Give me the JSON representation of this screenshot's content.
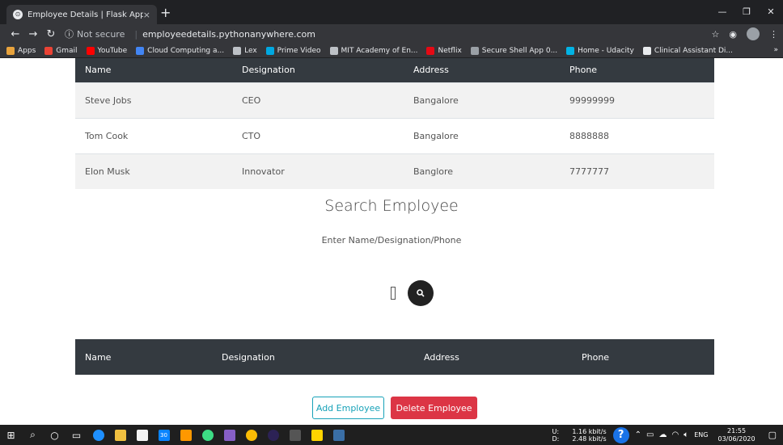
{
  "browser": {
    "tab_title": "Employee Details | Flask App",
    "tab_close": "×",
    "new_tab": "+",
    "not_secure": "Not secure",
    "url": "employeedetails.pythonanywhere.com",
    "bookmarks": [
      {
        "label": "Apps",
        "color": "#e8a33d"
      },
      {
        "label": "Gmail",
        "color": "#ea4335"
      },
      {
        "label": "YouTube",
        "color": "#ff0000"
      },
      {
        "label": "Cloud Computing a...",
        "color": "#4285f4"
      },
      {
        "label": "Lex",
        "color": "#bdc1c6"
      },
      {
        "label": "Prime Video",
        "color": "#00a8e1"
      },
      {
        "label": "MIT Academy of En...",
        "color": "#bdc1c6"
      },
      {
        "label": "Netflix",
        "color": "#e50914"
      },
      {
        "label": "Secure Shell App 0...",
        "color": "#9aa0a6"
      },
      {
        "label": "Home - Udacity",
        "color": "#02b3e4"
      },
      {
        "label": "Clinical Assistant Di...",
        "color": "#e8eaed"
      }
    ],
    "bookmarks_more": "»"
  },
  "top_table": {
    "headers": [
      "Name",
      "Designation",
      "Address",
      "Phone"
    ],
    "rows": [
      [
        "Steve Jobs",
        "CEO",
        "Bangalore",
        "99999999"
      ],
      [
        "Tom Cook",
        "CTO",
        "Bangalore",
        "8888888"
      ],
      [
        "Elon Musk",
        "Innovator",
        "Banglore",
        "7777777"
      ]
    ]
  },
  "search": {
    "title": "Search Employee",
    "hint": "Enter Name/Designation/Phone"
  },
  "bottom_table": {
    "headers": [
      "Name",
      "Designation",
      "Address",
      "Phone"
    ]
  },
  "actions": {
    "add_label": "Add Employee",
    "delete_label": "Delete Employee"
  },
  "taskbar": {
    "net_up_label": "U:",
    "net_down_label": "D:",
    "net_up": "1.16 kbit/s",
    "net_down": "2.48 kbit/s",
    "lang": "ENG",
    "time": "21:55",
    "date": "03/06/2020",
    "badge": "30"
  },
  "colors": {
    "header_dark": "#343a40",
    "add_border": "#17a2b8",
    "delete_bg": "#dc3545"
  }
}
